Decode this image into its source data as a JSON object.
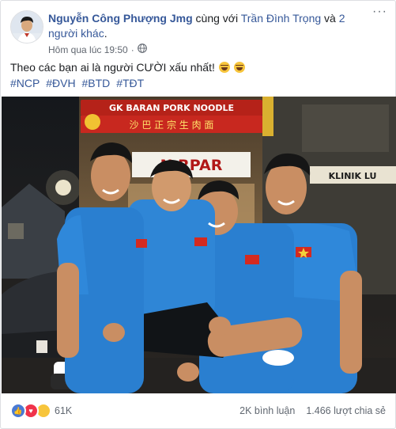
{
  "post": {
    "author": "Nguyễn Công Phượng Jmg",
    "with_text": " cùng với ",
    "tagged": "Trần Đình Trọng",
    "and_text": " và ",
    "others": "2 người khác",
    "period": ".",
    "timestamp": "Hôm qua lúc 19:50",
    "privacy_icon": "globe-icon",
    "text": "Theo các bạn ai là người CƯỜI xấu nhất!",
    "hashtags": [
      "#NCP",
      "#ĐVH",
      "#BTD",
      "#TĐT"
    ],
    "photo_signs": {
      "sign_top": "GK BARAN PORK NOODLE",
      "sign_chinese": "沙 巴 正 宗 生 肉 面",
      "sign_mid": "N  RPAR",
      "sign_right": "KLINIK LU"
    }
  },
  "footer": {
    "reaction_icons": [
      "like-icon",
      "love-icon",
      "haha-icon"
    ],
    "reaction_count": "61K",
    "comments": "2K bình luận",
    "shares": "1.466 lượt chia sẻ"
  },
  "colors": {
    "link": "#365899",
    "meta": "#616770",
    "jersey": "#2a7fd0"
  }
}
